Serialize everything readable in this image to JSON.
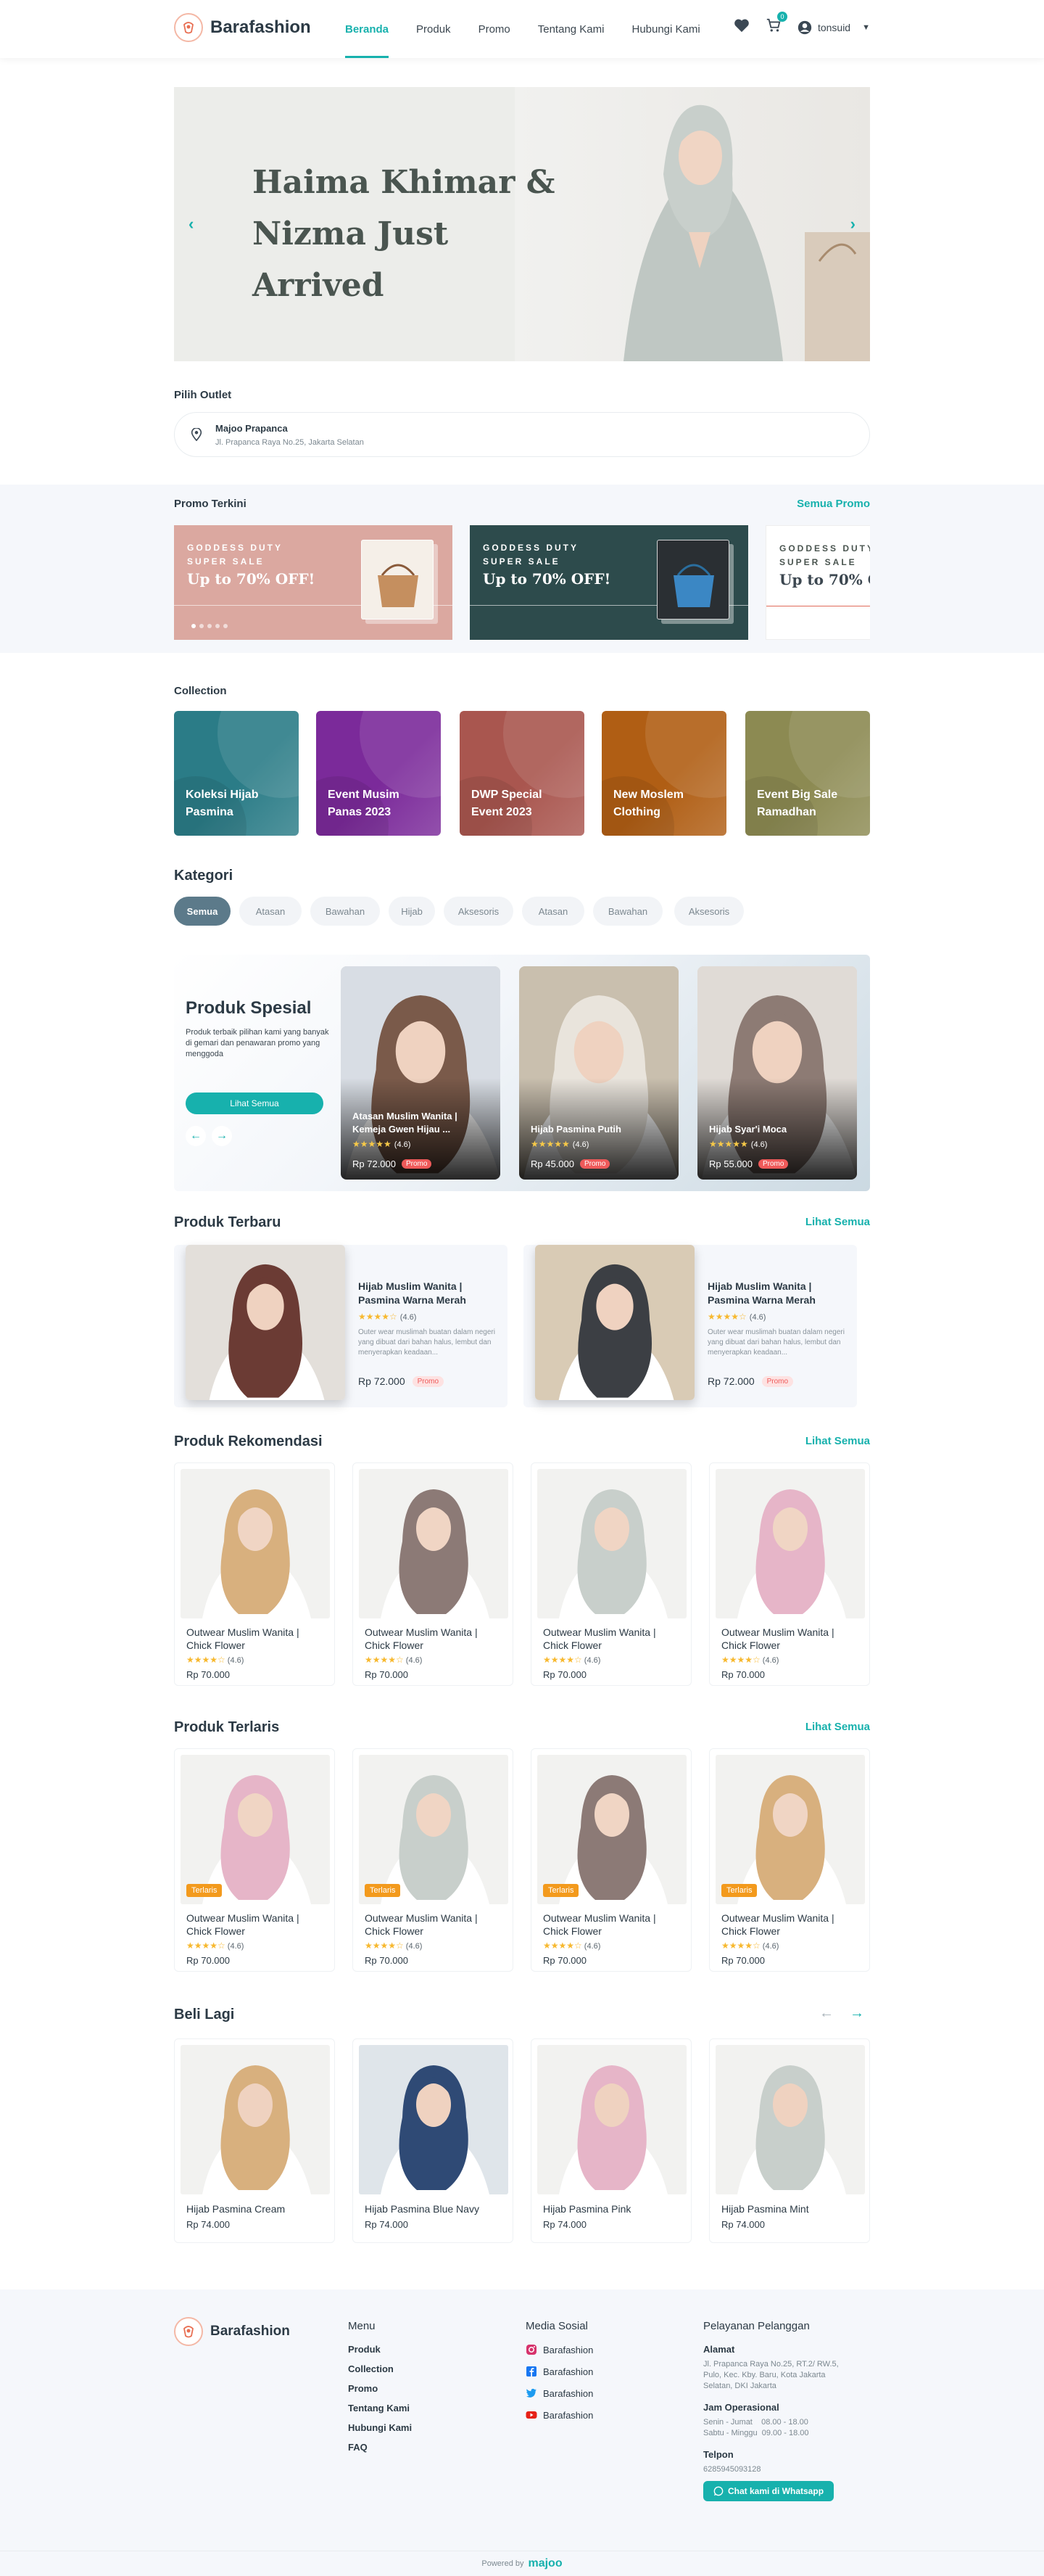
{
  "header": {
    "brand": "Barafashion",
    "nav": [
      "Beranda",
      "Produk",
      "Promo",
      "Tentang Kami",
      "Hubungi Kami"
    ],
    "cart_count": "0",
    "user": "tonsuid"
  },
  "hero": {
    "title": "Haima Khimar & Nizma Just Arrived"
  },
  "outlet": {
    "label": "Pilih Outlet",
    "name": "Majoo Prapanca",
    "address": "Jl. Prapanca Raya No.25, Jakarta Selatan"
  },
  "promo": {
    "title": "Promo Terkini",
    "link": "Semua Promo",
    "cards": [
      {
        "line1": "GODDESS DUTY",
        "line2": "SUPER SALE",
        "headline": "Up to 70% OFF!",
        "color": "#dba8a0"
      },
      {
        "line1": "GODDESS DUTY",
        "line2": "SUPER SALE",
        "headline": "Up to 70% OFF!",
        "color": "#2d4b4c"
      },
      {
        "line1": "GODDESS DUTY",
        "line2": "SUPER SALE",
        "headline": "Up to 70% OFF!",
        "color": "#ffffff"
      }
    ]
  },
  "collection": {
    "title": "Collection",
    "items": [
      {
        "label": "Koleksi Hijab Pasmina",
        "color": "#2b7c87"
      },
      {
        "label": "Event Musim Panas 2023",
        "color": "#7b2a9a"
      },
      {
        "label": "DWP Special Event 2023",
        "color": "#a9564f"
      },
      {
        "label": "New Moslem Clothing",
        "color": "#b05e14"
      },
      {
        "label": "Event Big Sale Ramadhan",
        "color": "#8c8a52"
      }
    ]
  },
  "kategori": {
    "title": "Kategori",
    "chips": [
      "Semua",
      "Atasan",
      "Bawahan",
      "Hijab",
      "Aksesoris",
      "Atasan",
      "Bawahan",
      "Aksesoris"
    ]
  },
  "spesial": {
    "title": "Produk Spesial",
    "desc": "Produk terbaik pilihan kami yang banyak di gemari dan penawaran promo yang menggoda",
    "button": "Lihat Semua",
    "items": [
      {
        "name": "Atasan Muslim Wanita | Kemeja Gwen Hijau ...",
        "rating": "(4.6)",
        "price": "Rp 72.000",
        "badge": "Promo"
      },
      {
        "name": "Hijab Pasmina Putih",
        "rating": "(4.6)",
        "price": "Rp 45.000",
        "badge": "Promo"
      },
      {
        "name": "Hijab Syar'i Moca",
        "rating": "(4.6)",
        "price": "Rp 55.000",
        "badge": "Promo"
      }
    ]
  },
  "terbaru": {
    "title": "Produk Terbaru",
    "link": "Lihat Semua",
    "items": [
      {
        "name": "Hijab Muslim Wanita | Pasmina Warna Merah",
        "rating": "(4.6)",
        "desc": "Outer wear muslimah buatan dalam negeri yang dibuat dari bahan halus, lembut dan menyerapkan keadaan...",
        "price": "Rp 72.000",
        "badge": "Promo"
      },
      {
        "name": "Hijab Muslim Wanita | Pasmina Warna Merah",
        "rating": "(4.6)",
        "desc": "Outer wear muslimah buatan dalam negeri yang dibuat dari bahan halus, lembut dan menyerapkan keadaan...",
        "price": "Rp 72.000",
        "badge": "Promo"
      }
    ]
  },
  "rekomendasi": {
    "title": "Produk Rekomendasi",
    "link": "Lihat Semua",
    "items": [
      {
        "name": "Outwear Muslim Wanita | Chick Flower",
        "rating": "(4.6)",
        "price": "Rp 70.000",
        "hijab": "#d8b07e"
      },
      {
        "name": "Outwear Muslim Wanita | Chick Flower",
        "rating": "(4.6)",
        "price": "Rp 70.000",
        "hijab": "#8c7a76"
      },
      {
        "name": "Outwear Muslim Wanita | Chick Flower",
        "rating": "(4.6)",
        "price": "Rp 70.000",
        "hijab": "#c8cfcb"
      },
      {
        "name": "Outwear Muslim Wanita | Chick Flower",
        "rating": "(4.6)",
        "price": "Rp 70.000",
        "hijab": "#e6b5c8"
      }
    ]
  },
  "terlaris": {
    "title": "Produk Terlaris",
    "link": "Lihat Semua",
    "badge": "Terlaris",
    "items": [
      {
        "name": "Outwear Muslim Wanita | Chick Flower",
        "rating": "(4.6)",
        "price": "Rp 70.000",
        "hijab": "#e6b5c8"
      },
      {
        "name": "Outwear Muslim Wanita | Chick Flower",
        "rating": "(4.6)",
        "price": "Rp 70.000",
        "hijab": "#c8cfcb"
      },
      {
        "name": "Outwear Muslim Wanita | Chick Flower",
        "rating": "(4.6)",
        "price": "Rp 70.000",
        "hijab": "#8c7a76"
      },
      {
        "name": "Outwear Muslim Wanita | Chick Flower",
        "rating": "(4.6)",
        "price": "Rp 70.000",
        "hijab": "#d8b07e"
      }
    ]
  },
  "beli_lagi": {
    "title": "Beli Lagi",
    "items": [
      {
        "name": "Hijab Pasmina Cream",
        "price": "Rp 74.000",
        "hijab": "#d8b07e"
      },
      {
        "name": "Hijab Pasmina Blue Navy",
        "price": "Rp 74.000",
        "hijab": "#2f4a75"
      },
      {
        "name": "Hijab Pasmina Pink",
        "price": "Rp 74.000",
        "hijab": "#e6b5c8"
      },
      {
        "name": "Hijab Pasmina Mint",
        "price": "Rp 74.000",
        "hijab": "#c8cfcb"
      }
    ]
  },
  "footer": {
    "brand": "Barafashion",
    "menu_title": "Menu",
    "menu": [
      "Produk",
      "Collection",
      "Promo",
      "Tentang Kami",
      "Hubungi Kami",
      "FAQ"
    ],
    "social_title": "Media Sosial",
    "social": [
      "Barafashion",
      "Barafashion",
      "Barafashion",
      "Barafashion"
    ],
    "service_title": "Pelayanan Pelanggan",
    "address_title": "Alamat",
    "address": "Jl. Prapanca Raya No.25, RT.2/ RW.5, Pulo, Kec. Kby. Baru, Kota Jakarta Selatan, DKI Jakarta",
    "hours_title": "Jam Operasional",
    "hours1": "Senin - Jumat    08.00 - 18.00",
    "hours2": "Sabtu - Minggu  09.00 - 18.00",
    "phone_title": "Telpon",
    "phone": "6285945093128",
    "wa_button": "Chat kami di Whatsapp",
    "powered": "Powered by",
    "powered_brand": "majoo"
  }
}
